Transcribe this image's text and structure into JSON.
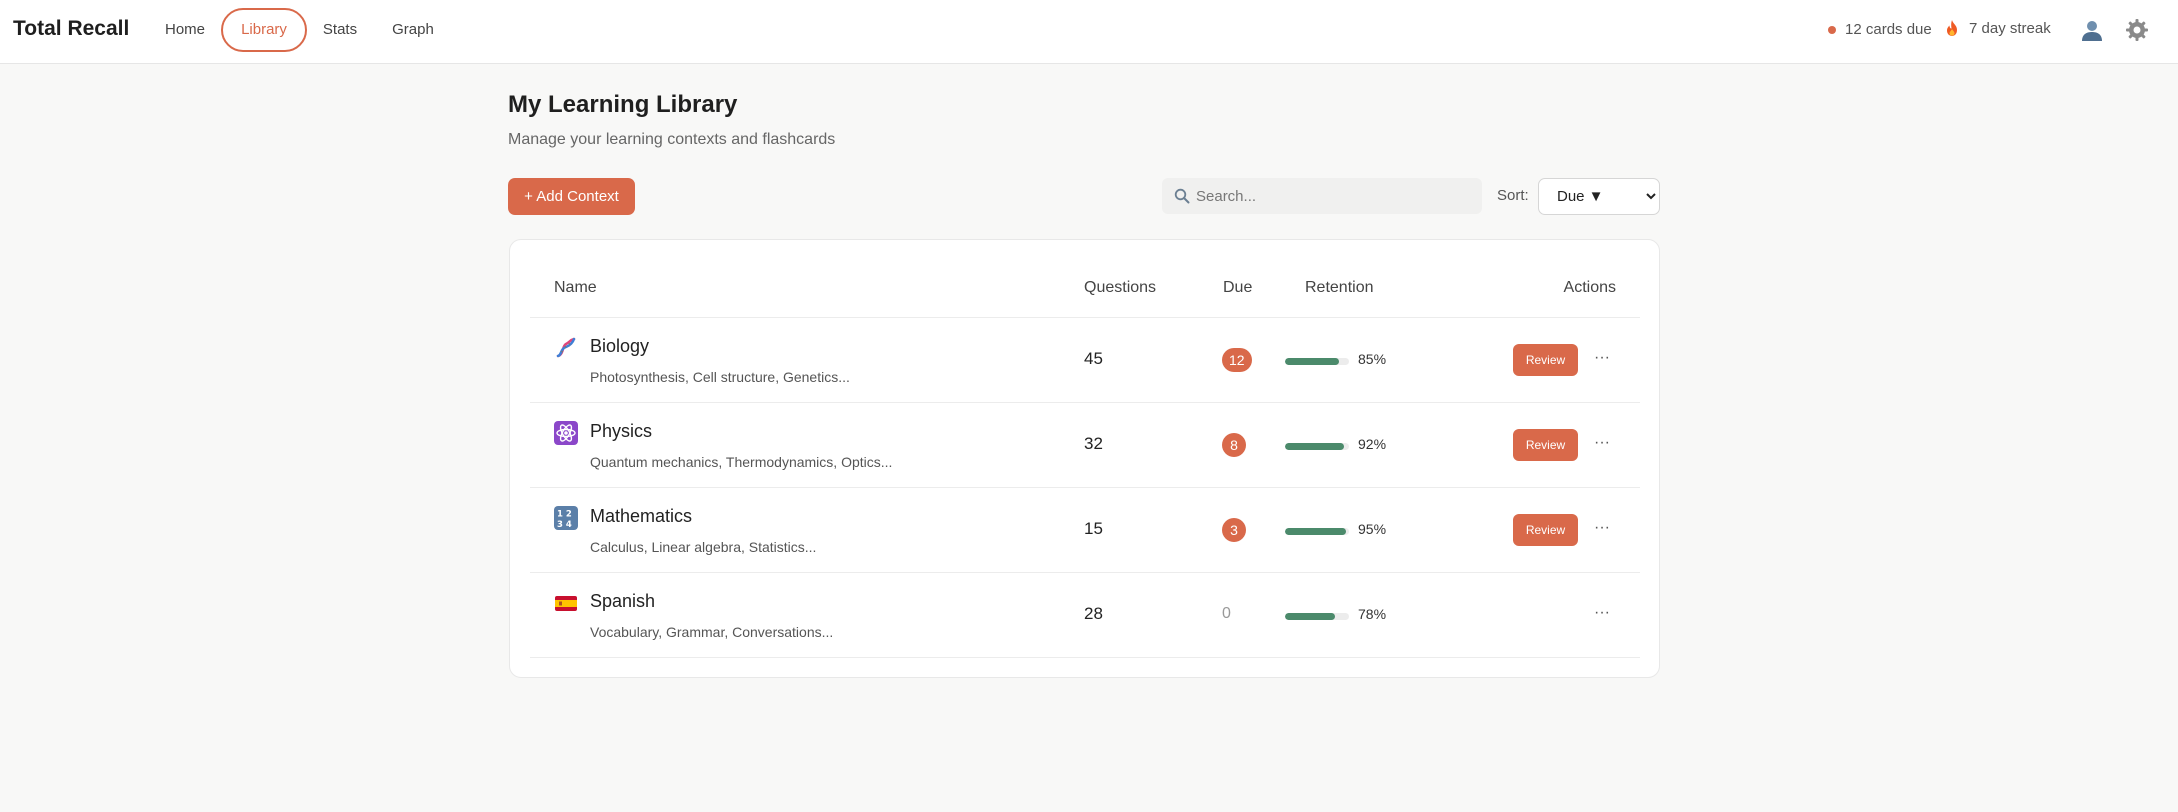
{
  "app": {
    "title": "Total Recall"
  },
  "nav": {
    "home": "Home",
    "library": "Library",
    "stats": "Stats",
    "graph": "Graph"
  },
  "status": {
    "due_text": "12 cards due",
    "streak_text": "7 day streak"
  },
  "page": {
    "title": "My Learning Library",
    "subtitle": "Manage your learning contexts and flashcards"
  },
  "toolbar": {
    "add_label": "+ Add Context",
    "search_placeholder": "Search...",
    "sort_label": "Sort:",
    "sort_value": "Due ▼"
  },
  "table": {
    "headers": {
      "name": "Name",
      "questions": "Questions",
      "due": "Due",
      "retention": "Retention",
      "actions": "Actions"
    },
    "review_label": "Review",
    "more_label": "···",
    "rows": [
      {
        "icon": "dna-icon",
        "name": "Biology",
        "topics": "Photosynthesis, Cell structure, Genetics...",
        "questions": "45",
        "due": "12",
        "retention_pct": 85,
        "retention_text": "85%"
      },
      {
        "icon": "atom-icon",
        "name": "Physics",
        "topics": "Quantum mechanics, Thermodynamics, Optics...",
        "questions": "32",
        "due": "8",
        "retention_pct": 92,
        "retention_text": "92%"
      },
      {
        "icon": "numbers-icon",
        "name": "Mathematics",
        "topics": "Calculus, Linear algebra, Statistics...",
        "questions": "15",
        "due": "3",
        "retention_pct": 95,
        "retention_text": "95%"
      },
      {
        "icon": "spain-flag-icon",
        "name": "Spanish",
        "topics": "Vocabulary, Grammar, Conversations...",
        "questions": "28",
        "due": "0",
        "retention_pct": 78,
        "retention_text": "78%"
      }
    ]
  },
  "colors": {
    "accent": "#d9694a",
    "retention_bar": "#4b8a6b"
  }
}
